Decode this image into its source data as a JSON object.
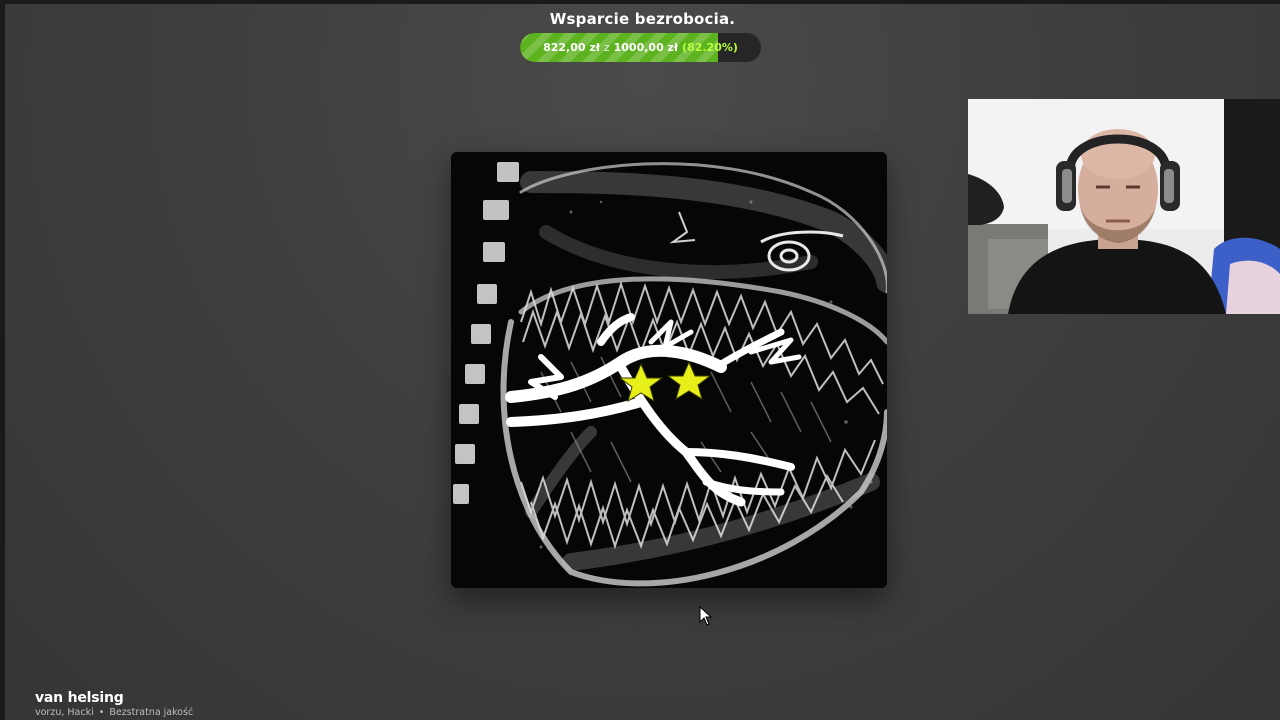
{
  "goal": {
    "title": "Wsparcie bezrobocia.",
    "current": "822,00 zł",
    "separator": "z",
    "target": "1000,00 zł",
    "percent_text": "(82.20%)",
    "progress_fraction": 0.822,
    "fill_color": "#5db21f",
    "percent_color": "#b6ff3a"
  },
  "album": {
    "icon": "album-cover-art",
    "star_color": "#e6ef1a"
  },
  "webcam": {
    "icon": "webcam-feed"
  },
  "now_playing": {
    "title": "van helsing",
    "artists": "vorzu, Hacki",
    "separator": "•",
    "quality": "Bezstratna jakość"
  }
}
